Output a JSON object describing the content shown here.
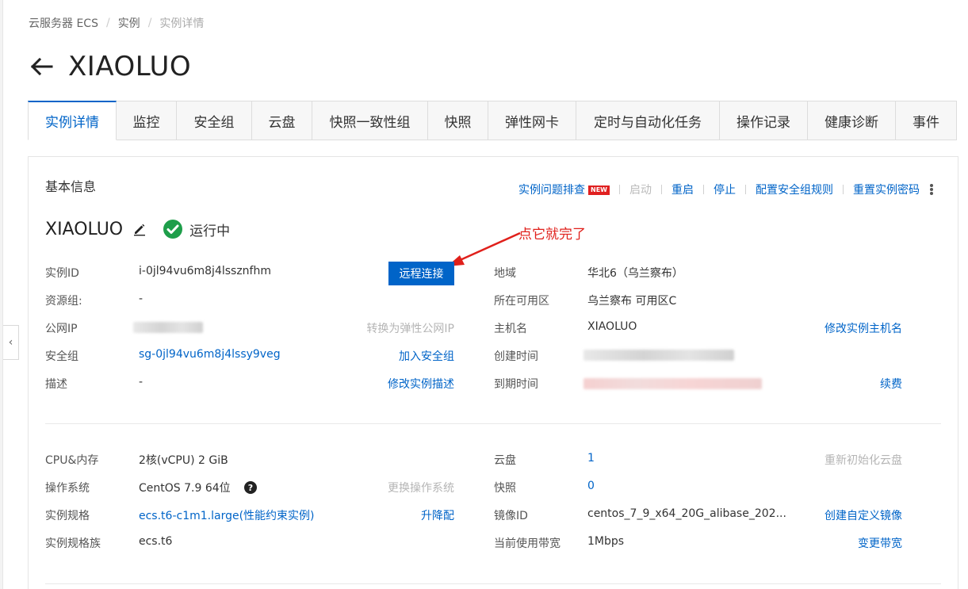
{
  "breadcrumb": {
    "items": [
      "云服务器 ECS",
      "实例",
      "实例详情"
    ]
  },
  "page": {
    "title": "XIAOLUO"
  },
  "tabs": [
    "实例详情",
    "监控",
    "安全组",
    "云盘",
    "快照一致性组",
    "快照",
    "弹性网卡",
    "定时与自动化任务",
    "操作记录",
    "健康诊断",
    "事件"
  ],
  "basic": {
    "section_title": "基本信息",
    "actions": {
      "troubleshoot": "实例问题排查",
      "new_badge": "NEW",
      "start": "启动",
      "restart": "重启",
      "stop": "停止",
      "config_sg_rules": "配置安全组规则",
      "reset_password": "重置实例密码"
    },
    "instance_name": "XIAOLUO",
    "status": "运行中",
    "annotation": "点它就完了",
    "remote_connect": "远程连接",
    "fields": {
      "instance_id_label": "实例ID",
      "instance_id_value": "i-0jl94vu6m8j4lssznfhm",
      "resource_group_label": "资源组:",
      "resource_group_value": "-",
      "public_ip_label": "公网IP",
      "convert_eip": "转换为弹性公网IP",
      "security_group_label": "安全组",
      "security_group_value": "sg-0jl94vu6m8j4lssy9veg",
      "join_sg": "加入安全组",
      "description_label": "描述",
      "description_value": "-",
      "modify_description": "修改实例描述",
      "region_label": "地域",
      "region_value": "华北6（乌兰察布）",
      "zone_label": "所在可用区",
      "zone_value": "乌兰察布 可用区C",
      "hostname_label": "主机名",
      "hostname_value": "XIAOLUO",
      "modify_hostname": "修改实例主机名",
      "created_label": "创建时间",
      "expire_label": "到期时间",
      "renew": "续费"
    }
  },
  "config": {
    "cpu_mem_label": "CPU&内存",
    "cpu_mem_value": "2核(vCPU) 2 GiB",
    "os_label": "操作系统",
    "os_value": "CentOS 7.9 64位",
    "change_os": "更换操作系统",
    "spec_label": "实例规格",
    "spec_value": "ecs.t6-c1m1.large(性能约束实例)",
    "upgrade": "升降配",
    "family_label": "实例规格族",
    "family_value": "ecs.t6",
    "disk_label": "云盘",
    "disk_value": "1",
    "reinit_disk": "重新初始化云盘",
    "snapshot_label": "快照",
    "snapshot_value": "0",
    "image_label": "镜像ID",
    "image_value": "centos_7_9_x64_20G_alibase_202...",
    "create_image": "创建自定义镜像",
    "bandwidth_label": "当前使用带宽",
    "bandwidth_value": "1Mbps",
    "change_bandwidth": "变更带宽"
  },
  "colors": {
    "accent": "#0064c8",
    "status_ok": "#1e9e4a",
    "annotation": "#e0201b"
  }
}
